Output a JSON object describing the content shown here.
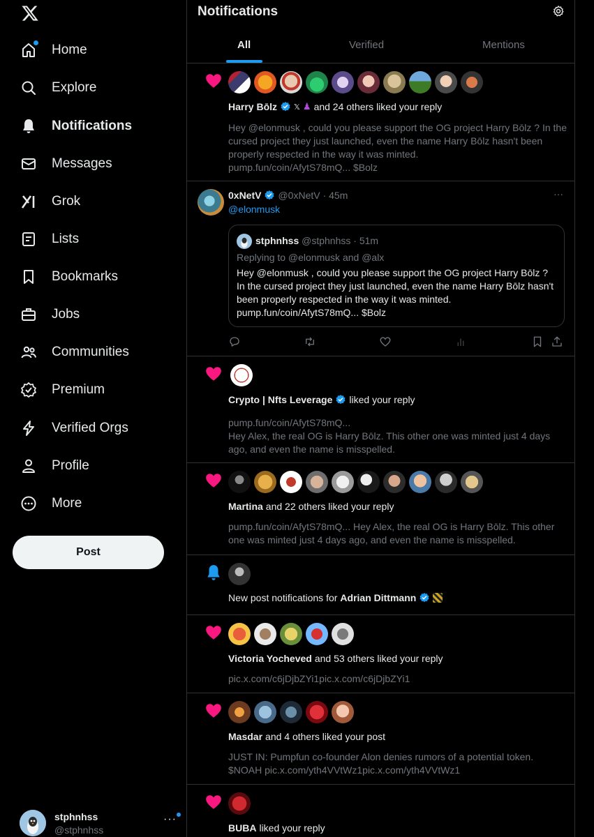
{
  "sidebar": {
    "items": [
      {
        "label": "Home",
        "icon": "home-icon"
      },
      {
        "label": "Explore",
        "icon": "search-icon"
      },
      {
        "label": "Notifications",
        "icon": "bell-icon"
      },
      {
        "label": "Messages",
        "icon": "envelope-icon"
      },
      {
        "label": "Grok",
        "icon": "grok-icon"
      },
      {
        "label": "Lists",
        "icon": "list-icon"
      },
      {
        "label": "Bookmarks",
        "icon": "bookmark-icon"
      },
      {
        "label": "Jobs",
        "icon": "briefcase-icon"
      },
      {
        "label": "Communities",
        "icon": "people-icon"
      },
      {
        "label": "Premium",
        "icon": "premium-icon"
      },
      {
        "label": "Verified Orgs",
        "icon": "lightning-icon"
      },
      {
        "label": "Profile",
        "icon": "person-icon"
      },
      {
        "label": "More",
        "icon": "more-circle-icon"
      }
    ],
    "post_label": "Post",
    "account": {
      "name": "stphnhss",
      "handle": "@stphnhss"
    }
  },
  "header": {
    "title": "Notifications",
    "tabs": [
      "All",
      "Verified",
      "Mentions"
    ]
  },
  "notifications": {
    "n1": {
      "name": "Harry Bōlz",
      "rest": "and 24 others liked your reply",
      "snippet": "Hey @elonmusk , could you please support the OG project Harry Bōlz ? In the cursed project they just launched, even the name Harry Bōlz hasn't been properly respected in the way it was minted.",
      "snippet2": "pump.fun/coin/AfytS78mQ...   $Bolz"
    },
    "tweet": {
      "name": "0xNetV",
      "handle": "@0xNetV",
      "time": "· 45m",
      "mention": "@elonmusk",
      "quote_name": "stphnhss",
      "quote_handle": "@stphnhss",
      "quote_time": "· 51m",
      "replying": "Replying to @elonmusk and @alx",
      "quote_text": "Hey @elonmusk , could you please support the OG project Harry Bōlz ? In the cursed project they just launched, even the name Harry Bōlz hasn't been properly respected in the way it was minted.",
      "quote_link": "pump.fun/coin/AfytS78mQ...   $Bolz",
      "more": "···"
    },
    "n2": {
      "name": "Crypto | Nfts Leverage",
      "rest": "liked your reply",
      "snippet_link": "pump.fun/coin/AfytS78mQ...",
      "snippet": "Hey Alex, the real OG is Harry Bōlz. This other one was minted just 4 days ago, and even the name is misspelled."
    },
    "n3": {
      "name": "Martina",
      "rest": "and 22 others liked your reply",
      "snippet": "pump.fun/coin/AfytS78mQ...  Hey Alex, the real OG is Harry Bōlz. This other one was minted just 4 days ago, and even the name is misspelled."
    },
    "n4": {
      "prefix": "New post notifications for",
      "name": "Adrian Dittmann"
    },
    "n5": {
      "name": "Victoria Yocheved",
      "rest": "and 53 others liked your reply",
      "snippet": "pic.x.com/c6jDjbZYi1pic.x.com/c6jDjbZYi1"
    },
    "n6": {
      "name": "Masdar",
      "rest": "and 4 others liked your post",
      "snippet": "JUST IN: Pumpfun co-founder Alon denies rumors of a potential token. $NOAH pic.x.com/yth4VVtWz1pic.x.com/yth4VVtWz1"
    },
    "n7": {
      "name": "BUBA",
      "rest": "liked your reply"
    }
  },
  "colors": {
    "background": "#000000",
    "text": "#e7e9ea",
    "muted": "#71767b",
    "accent": "#1d9bf0",
    "like": "#f91880",
    "border": "#2f3336"
  }
}
